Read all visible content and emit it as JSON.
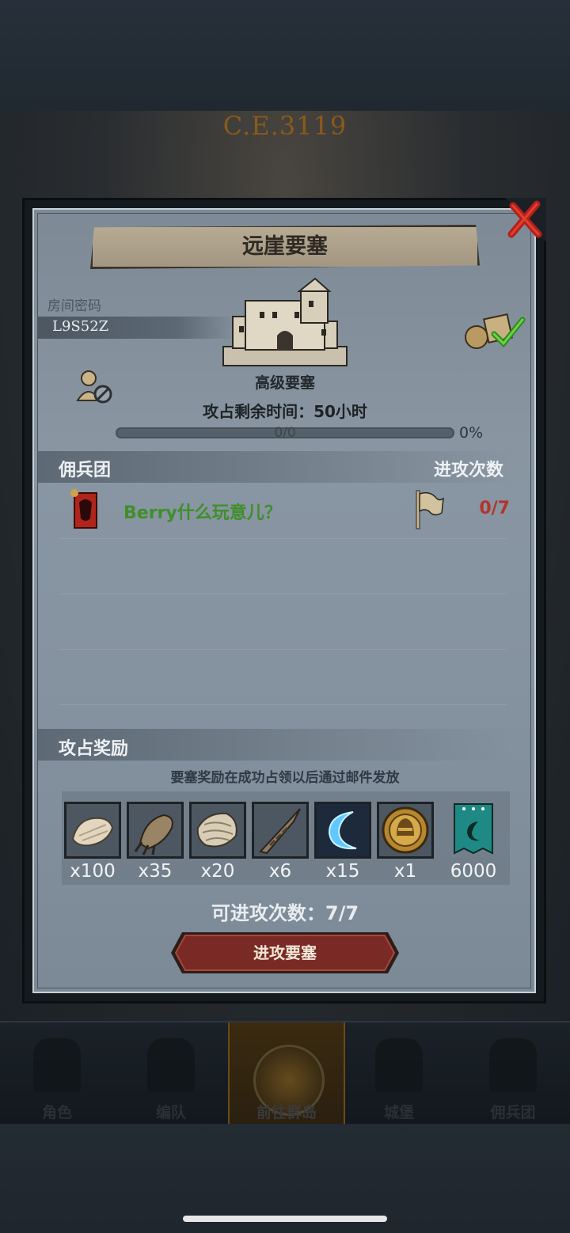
{
  "header": {
    "year": "C.E.3119"
  },
  "dialog": {
    "title": "远崖要塞",
    "room_password_label": "房间密码",
    "room_password": "L9S52Z",
    "fortress_grade": "高级要塞",
    "time_left": "攻占剩余时间：50小时",
    "progress": {
      "text": "0/0",
      "percent_label": "0%",
      "value": 0
    },
    "guild_header": "佣兵团",
    "attacks_header": "进攻次数",
    "guild_row": {
      "name": "Berry什么玩意儿？",
      "attacks": "0/7"
    },
    "rewards_header": "攻占奖励",
    "rewards_note": "要塞奖励在成功占领以后通过邮件发放",
    "rewards": [
      {
        "icon": "fur-pelt-icon",
        "qty": "x100"
      },
      {
        "icon": "claw-icon",
        "qty": "x35"
      },
      {
        "icon": "scale-hide-icon",
        "qty": "x20"
      },
      {
        "icon": "horn-icon",
        "qty": "x6"
      },
      {
        "icon": "blue-crescent-icon",
        "qty": "x15"
      },
      {
        "icon": "knight-medal-icon",
        "qty": "x1"
      },
      {
        "icon": "guild-banner-icon",
        "qty": "6000"
      }
    ],
    "remaining_attacks": "可进攻次数：7/7",
    "attack_button": "进攻要塞"
  },
  "nav": {
    "items": [
      {
        "label": "角色"
      },
      {
        "label": "编队"
      },
      {
        "label": "前往群岛"
      },
      {
        "label": "城堡"
      },
      {
        "label": "佣兵团"
      }
    ],
    "active_index": 2
  },
  "colors": {
    "guild_name": "#3f8f2a",
    "attack_count": "#b3342c",
    "button": "#7a2a24",
    "panel": "#8592a0"
  }
}
